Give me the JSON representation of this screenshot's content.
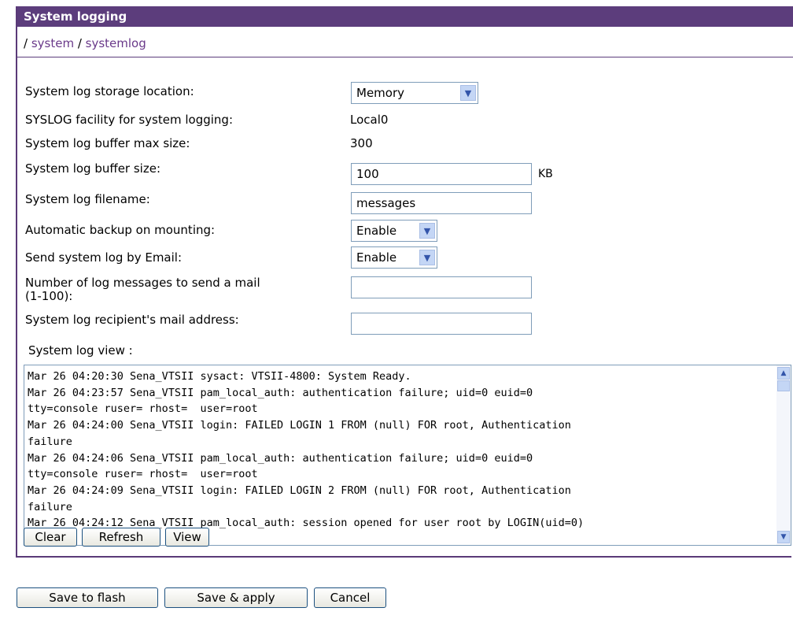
{
  "header": {
    "title": "System logging"
  },
  "breadcrumb": {
    "sep1": "/ ",
    "item1": "system",
    "sep2": " / ",
    "item2": "systemlog"
  },
  "form": {
    "storage_location": {
      "label": "System log storage location:",
      "value": "Memory"
    },
    "syslog_facility": {
      "label": "SYSLOG facility for system logging:",
      "value": "Local0"
    },
    "buffer_max_size": {
      "label": "System log buffer max size:",
      "value": "300"
    },
    "buffer_size": {
      "label": "System log buffer size:",
      "value": "100",
      "unit": "KB"
    },
    "filename": {
      "label": "System log filename:",
      "value": "messages"
    },
    "auto_backup": {
      "label": "Automatic backup on mounting:",
      "value": "Enable"
    },
    "send_email": {
      "label": "Send system log by Email:",
      "value": "Enable"
    },
    "num_messages": {
      "label_line1": "Number of log messages to send a mail",
      "label_line2": "(1-100):",
      "value": ""
    },
    "recipient": {
      "label": "System log recipient's mail address:",
      "value": ""
    }
  },
  "log_view": {
    "label": "System log view :",
    "content": "Mar 26 04:20:30 Sena_VTSII sysact: VTSII-4800: System Ready.\nMar 26 04:23:57 Sena_VTSII pam_local_auth: authentication failure; uid=0 euid=0\ntty=console ruser= rhost=  user=root\nMar 26 04:24:00 Sena_VTSII login: FAILED LOGIN 1 FROM (null) FOR root, Authentication\nfailure\nMar 26 04:24:06 Sena_VTSII pam_local_auth: authentication failure; uid=0 euid=0\ntty=console ruser= rhost=  user=root\nMar 26 04:24:09 Sena_VTSII login: FAILED LOGIN 2 FROM (null) FOR root, Authentication\nfailure\nMar 26 04:24:12 Sena_VTSII pam_local_auth: session opened for user root by LOGIN(uid=0)",
    "buttons": {
      "clear": "Clear",
      "refresh": "Refresh",
      "view": "View"
    }
  },
  "footer": {
    "save_flash": "Save to flash",
    "save_apply": "Save & apply",
    "cancel": "Cancel"
  },
  "icons": {
    "dropdown": "chevron-down-icon",
    "scroll_up": "arrow-up-icon",
    "scroll_down": "arrow-down-icon"
  },
  "colors": {
    "header_bg": "#5c3d7c",
    "link": "#6a3a8a",
    "button_border": "#1c5180"
  }
}
